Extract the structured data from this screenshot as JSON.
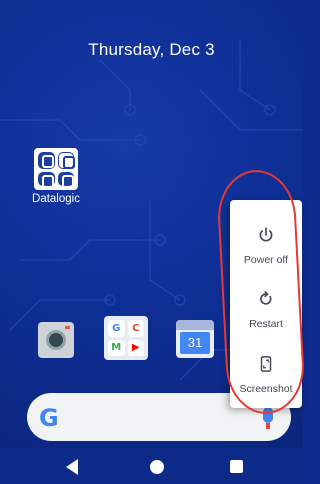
{
  "home": {
    "date": "Thursday, Dec 3",
    "folder_label": "Datalogic"
  },
  "calendar_icon": {
    "day": "31"
  },
  "google_folder": {
    "glyphs": [
      "G",
      "C",
      "M",
      "▶"
    ]
  },
  "search_bar": {
    "logo": "G"
  },
  "power_menu": {
    "items": [
      {
        "label": "Power off",
        "icon": "power-icon"
      },
      {
        "label": "Restart",
        "icon": "restart-icon"
      },
      {
        "label": "Screenshot",
        "icon": "screenshot-icon"
      }
    ]
  },
  "colors": {
    "wallpaper": "#0f2f96",
    "annotation_ring": "#e53935",
    "menu_text": "#444b55"
  }
}
